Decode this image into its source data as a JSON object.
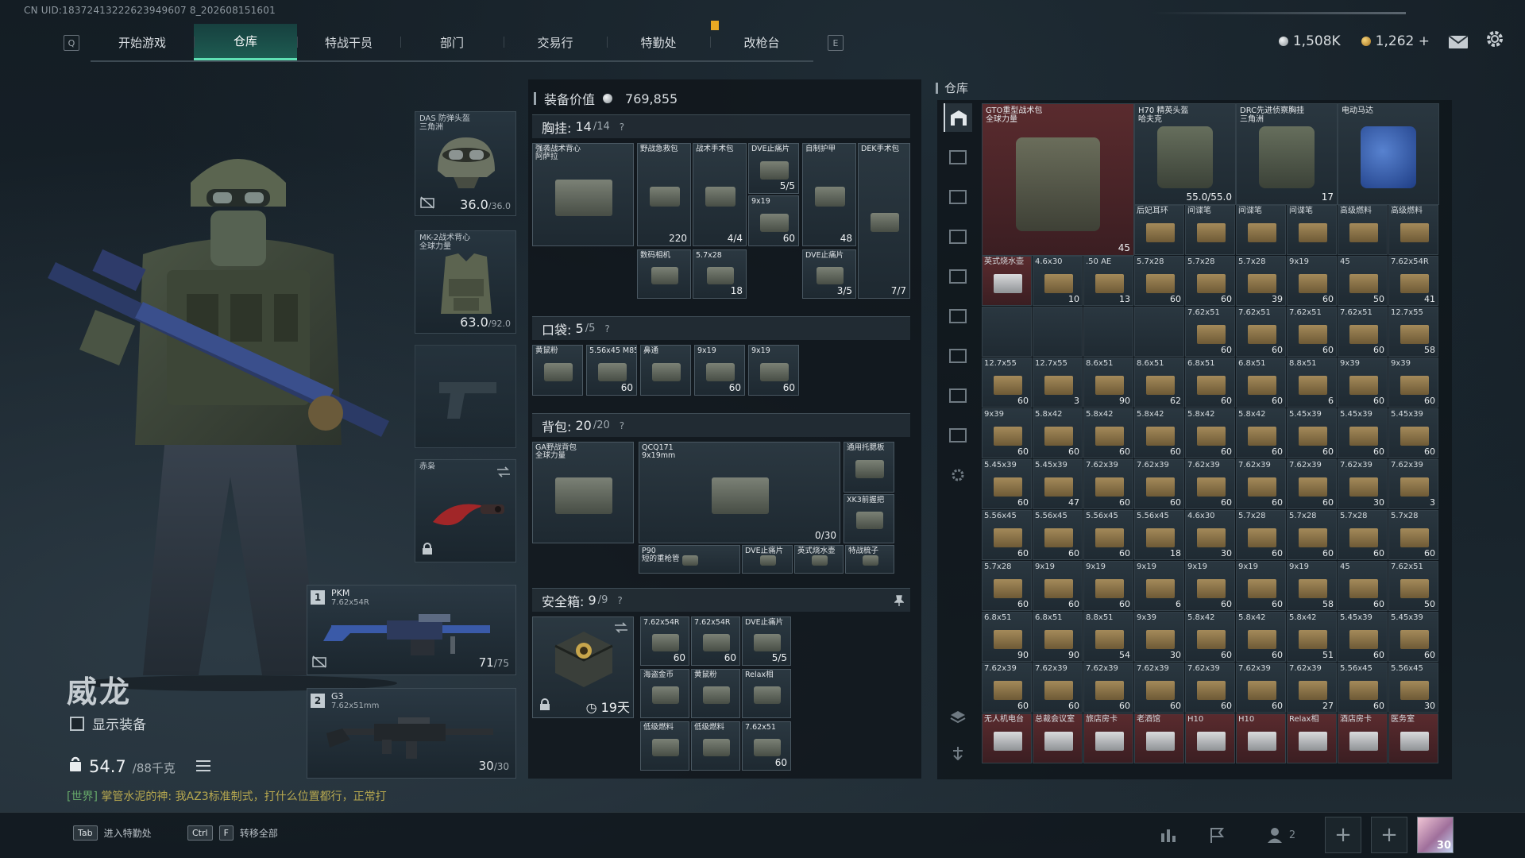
{
  "uid": "CN UID:18372413222623949607 8_202608151601",
  "nav": {
    "left_key": "Q",
    "right_key": "E",
    "tabs": [
      "开始游戏",
      "仓库",
      "特战干员",
      "部门",
      "交易行",
      "特勤处",
      "改枪台"
    ],
    "active": 1
  },
  "currency": {
    "silver": "1,508K",
    "gold": "1,262",
    "gold_plus": "+"
  },
  "operator": {
    "name": "威龙",
    "show_equipment": "显示装备",
    "weight": "54.7",
    "weight_cap": "/88千克"
  },
  "chat": {
    "channel": "[世界]",
    "sender": "掌管水泥的神:",
    "message": "我AZ3标准制式，打什么位置都行，正常打"
  },
  "hints": {
    "tab_key": "Tab",
    "tab_label": "进入特勤处",
    "ctrl_key": "Ctrl",
    "f_key": "F",
    "ctrl_label": "转移全部"
  },
  "bottom": {
    "friends_count": "2",
    "avatar_level": "30"
  },
  "slots": {
    "helmet": {
      "label": "DAS 防弹头盔\n三角洲",
      "value": "36.0",
      "max": "/36.0"
    },
    "armor": {
      "label": "MK-2战术背心\n全球力量",
      "value": "63.0",
      "max": "/92.0"
    },
    "knife": {
      "label": "赤枭"
    },
    "primary": {
      "num": "1",
      "name": "PKM",
      "cal": "7.62x54R",
      "ammo": "71",
      "ammo_max": "/75"
    },
    "secondary": {
      "num": "2",
      "name": "G3",
      "cal": "7.62x51mm",
      "ammo": "30",
      "ammo_max": "/30"
    }
  },
  "equipment_value": {
    "label": "装备价值",
    "value": "769,855"
  },
  "chest": {
    "label": "胸挂:",
    "count": "14",
    "cap": "/14",
    "help": "?"
  },
  "chest_items": [
    {
      "t": "强袭战术背心\n阿萨拉",
      "c": ""
    },
    {
      "t": "野战急救包",
      "c": "220"
    },
    {
      "t": "战术手术包",
      "c": "4/4"
    },
    {
      "t": "DVE止痛片",
      "c": "5/5"
    },
    {
      "t": "9x19",
      "c": "60"
    },
    {
      "t": "自制护甲",
      "c": "48"
    },
    {
      "t": "DEK手术包",
      "c": "7/7"
    },
    {
      "t": "数码相机",
      "c": ""
    },
    {
      "t": "5.7x28",
      "c": "18"
    },
    {
      "t": "DVE止痛片",
      "c": "3/5"
    }
  ],
  "pocket": {
    "label": "口袋:",
    "count": "5",
    "cap": "/5",
    "help": "?"
  },
  "pocket_items": [
    {
      "t": "黄鼠粉",
      "c": ""
    },
    {
      "t": "5.56x45 M855",
      "c": "60"
    },
    {
      "t": "鼻通",
      "c": ""
    },
    {
      "t": "9x19",
      "c": "60"
    },
    {
      "t": "9x19",
      "c": "60"
    }
  ],
  "backpack": {
    "label": "背包:",
    "count": "20",
    "cap": "/20",
    "help": "?"
  },
  "backpack_items": [
    {
      "t": "GA野战背包\n全球力量",
      "c": ""
    },
    {
      "t": "QCQ171\n9x19mm",
      "c": "0/30"
    },
    {
      "t": "通用托腮板",
      "c": ""
    },
    {
      "t": "XK3前握把",
      "c": ""
    },
    {
      "t": "P90\n短的重枪管",
      "c": ""
    },
    {
      "t": "DVE止痛片",
      "c": ""
    },
    {
      "t": "英式烧水壶",
      "c": ""
    },
    {
      "t": "特战梳子",
      "c": ""
    }
  ],
  "safe": {
    "label": "安全箱:",
    "count": "9",
    "cap": "/9",
    "help": "?",
    "days": "19天"
  },
  "safe_items": [
    {
      "t": "7.62x54R",
      "c": "60"
    },
    {
      "t": "7.62x54R",
      "c": "60"
    },
    {
      "t": "DVE止痛片",
      "c": "5/5"
    },
    {
      "t": "海盗金币",
      "c": ""
    },
    {
      "t": "黄鼠粉",
      "c": ""
    },
    {
      "t": "Relax相",
      "c": ""
    },
    {
      "t": "低级燃料",
      "c": ""
    },
    {
      "t": "低级燃料",
      "c": ""
    },
    {
      "t": "7.62x51",
      "c": "60"
    }
  ],
  "warehouse": {
    "title": "仓库",
    "big_items": [
      {
        "t": "GTO重型战术包\n全球力量",
        "c": "45"
      },
      {
        "t": "H70 精英头盔\n哈夫克",
        "c": "55.0/55.0"
      },
      {
        "t": "DRC先进侦察胸挂\n三角洲",
        "c": "17"
      },
      {
        "t": "电动马达",
        "c": ""
      }
    ],
    "row_small": [
      {
        "t": "后妃耳环",
        "c": ""
      },
      {
        "t": "间谍笔",
        "c": ""
      },
      {
        "t": "间谍笔",
        "c": ""
      },
      {
        "t": "间谍笔",
        "c": ""
      },
      {
        "t": "高级燃料",
        "c": ""
      },
      {
        "t": "高级燃料",
        "c": ""
      }
    ],
    "rows": [
      [
        {
          "t": "英式烧水壶",
          "c": "",
          "k": "red"
        },
        {
          "t": "4.6x30",
          "c": "10"
        },
        {
          "t": ".50 AE",
          "c": "13"
        },
        {
          "t": "5.7x28",
          "c": "60"
        },
        {
          "t": "5.7x28",
          "c": "60"
        },
        {
          "t": "5.7x28",
          "c": "39"
        },
        {
          "t": "9x19",
          "c": "60"
        },
        {
          "t": "45",
          "c": "50"
        },
        {
          "t": "7.62x54R",
          "c": "41"
        }
      ],
      [
        {
          "t": "",
          "c": ""
        },
        {
          "t": "",
          "c": ""
        },
        {
          "t": "",
          "c": ""
        },
        {
          "t": "",
          "c": ""
        },
        {
          "t": "7.62x51",
          "c": "60"
        },
        {
          "t": "7.62x51",
          "c": "60"
        },
        {
          "t": "7.62x51",
          "c": "60"
        },
        {
          "t": "7.62x51",
          "c": "60"
        },
        {
          "t": "12.7x55",
          "c": "58"
        }
      ],
      [
        {
          "t": "12.7x55",
          "c": "60"
        },
        {
          "t": "12.7x55",
          "c": "3"
        },
        {
          "t": "8.6x51",
          "c": "90"
        },
        {
          "t": "8.6x51",
          "c": "62"
        },
        {
          "t": "6.8x51",
          "c": "60"
        },
        {
          "t": "6.8x51",
          "c": "60"
        },
        {
          "t": "8.8x51",
          "c": "6"
        },
        {
          "t": "9x39",
          "c": "60"
        },
        {
          "t": "9x39",
          "c": "60"
        }
      ],
      [
        {
          "t": "9x39",
          "c": "60"
        },
        {
          "t": "5.8x42",
          "c": "60"
        },
        {
          "t": "5.8x42",
          "c": "60"
        },
        {
          "t": "5.8x42",
          "c": "60"
        },
        {
          "t": "5.8x42",
          "c": "60"
        },
        {
          "t": "5.8x42",
          "c": "60"
        },
        {
          "t": "5.45x39",
          "c": "60"
        },
        {
          "t": "5.45x39",
          "c": "60"
        },
        {
          "t": "5.45x39",
          "c": "60"
        }
      ],
      [
        {
          "t": "5.45x39",
          "c": "60"
        },
        {
          "t": "5.45x39",
          "c": "47"
        },
        {
          "t": "7.62x39",
          "c": "60"
        },
        {
          "t": "7.62x39",
          "c": "60"
        },
        {
          "t": "7.62x39",
          "c": "60"
        },
        {
          "t": "7.62x39",
          "c": "60"
        },
        {
          "t": "7.62x39",
          "c": "60"
        },
        {
          "t": "7.62x39",
          "c": "30"
        },
        {
          "t": "7.62x39",
          "c": "3"
        }
      ],
      [
        {
          "t": "5.56x45",
          "c": "60"
        },
        {
          "t": "5.56x45",
          "c": "60"
        },
        {
          "t": "5.56x45",
          "c": "60"
        },
        {
          "t": "5.56x45",
          "c": "18"
        },
        {
          "t": "4.6x30",
          "c": "30"
        },
        {
          "t": "5.7x28",
          "c": "60"
        },
        {
          "t": "5.7x28",
          "c": "60"
        },
        {
          "t": "5.7x28",
          "c": "60"
        },
        {
          "t": "5.7x28",
          "c": "60"
        }
      ],
      [
        {
          "t": "5.7x28",
          "c": "60"
        },
        {
          "t": "9x19",
          "c": "60"
        },
        {
          "t": "9x19",
          "c": "60"
        },
        {
          "t": "9x19",
          "c": "6"
        },
        {
          "t": "9x19",
          "c": "60"
        },
        {
          "t": "9x19",
          "c": "60"
        },
        {
          "t": "9x19",
          "c": "58"
        },
        {
          "t": "45",
          "c": "60"
        },
        {
          "t": "7.62x51",
          "c": "50"
        }
      ],
      [
        {
          "t": "6.8x51",
          "c": "90"
        },
        {
          "t": "6.8x51",
          "c": "90"
        },
        {
          "t": "8.8x51",
          "c": "54"
        },
        {
          "t": "9x39",
          "c": "30"
        },
        {
          "t": "5.8x42",
          "c": "60"
        },
        {
          "t": "5.8x42",
          "c": "60"
        },
        {
          "t": "5.8x42",
          "c": "51"
        },
        {
          "t": "5.45x39",
          "c": "60"
        },
        {
          "t": "5.45x39",
          "c": "60"
        }
      ],
      [
        {
          "t": "7.62x39",
          "c": "60"
        },
        {
          "t": "7.62x39",
          "c": "60"
        },
        {
          "t": "7.62x39",
          "c": "60"
        },
        {
          "t": "7.62x39",
          "c": "60"
        },
        {
          "t": "7.62x39",
          "c": "60"
        },
        {
          "t": "7.62x39",
          "c": "60"
        },
        {
          "t": "7.62x39",
          "c": "27"
        },
        {
          "t": "5.56x45",
          "c": "60"
        },
        {
          "t": "5.56x45",
          "c": "30"
        }
      ],
      [
        {
          "t": "无人机电台",
          "c": "",
          "k": "red"
        },
        {
          "t": "总裁会议室",
          "c": "",
          "k": "red"
        },
        {
          "t": "旅店房卡",
          "c": "",
          "k": "red"
        },
        {
          "t": "老酒馆",
          "c": "",
          "k": "red"
        },
        {
          "t": "H10",
          "c": "",
          "k": "red"
        },
        {
          "t": "H10",
          "c": "",
          "k": "red"
        },
        {
          "t": "Relax相",
          "c": "",
          "k": "red"
        },
        {
          "t": "酒店房卡",
          "c": "",
          "k": "red"
        },
        {
          "t": "医务室",
          "c": "",
          "k": "red"
        }
      ]
    ]
  }
}
